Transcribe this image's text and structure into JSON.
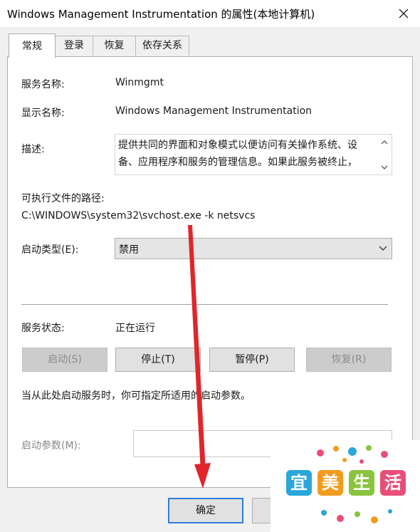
{
  "window": {
    "title": "Windows Management Instrumentation 的属性(本地计算机)"
  },
  "tabs": [
    {
      "label": "常规",
      "active": true
    },
    {
      "label": "登录",
      "active": false
    },
    {
      "label": "恢复",
      "active": false
    },
    {
      "label": "依存关系",
      "active": false
    }
  ],
  "general": {
    "service_name_label": "服务名称:",
    "service_name_value": "Winmgmt",
    "display_name_label": "显示名称:",
    "display_name_value": "Windows Management Instrumentation",
    "description_label": "描述:",
    "description_text": "提供共同的界面和对象模式以便访问有关操作系统、设备、应用程序和服务的管理信息。如果此服务被终止，",
    "exec_path_label": "可执行文件的路径:",
    "exec_path_value": "C:\\WINDOWS\\system32\\svchost.exe -k netsvcs",
    "startup_type_label": "启动类型(E):",
    "startup_type_value": "禁用",
    "service_status_label": "服务状态:",
    "service_status_value": "正在运行",
    "buttons": {
      "start": "启动(S)",
      "stop": "停止(T)",
      "pause": "暂停(P)",
      "resume": "恢复(R)"
    },
    "hint_text": "当从此处启动服务时，你可指定所适用的启动参数。",
    "start_params_label": "启动参数(M):",
    "start_params_value": ""
  },
  "footer": {
    "ok_label": "确定"
  },
  "watermark": {
    "chars": [
      "宜",
      "美",
      "生",
      "活"
    ]
  },
  "colors": {
    "accent": "#2f7dd8",
    "arrow": "#e0262b",
    "wm1": "#2aa6d9",
    "wm2": "#f29c1f",
    "wm3": "#8ac43f",
    "wm4": "#e94e77"
  }
}
